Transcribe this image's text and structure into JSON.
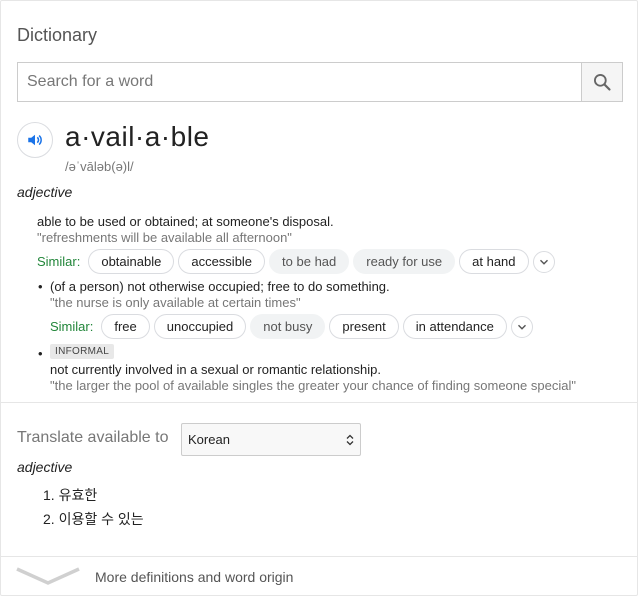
{
  "header": {
    "title": "Dictionary"
  },
  "search": {
    "placeholder": "Search for a word",
    "value": ""
  },
  "entry": {
    "headword": "a·vail·a·ble",
    "phonetic": "/əˈvāləb(ə)l/",
    "pos": "adjective",
    "senses": [
      {
        "definition": "able to be used or obtained; at someone's disposal.",
        "example": "\"refreshments will be available all afternoon\"",
        "similar_label": "Similar:",
        "similar": [
          "obtainable",
          "accessible",
          "to be had",
          "ready for use",
          "at hand"
        ]
      },
      {
        "bullet": "•",
        "definition": "(of a person) not otherwise occupied; free to do something.",
        "example": "\"the nurse is only available at certain times\"",
        "similar_label": "Similar:",
        "similar": [
          "free",
          "unoccupied",
          "not busy",
          "present",
          "in attendance"
        ]
      },
      {
        "bullet": "•",
        "tag": "INFORMAL",
        "definition": "not currently involved in a sexual or romantic relationship.",
        "example": "\"the larger the pool of available singles the greater your chance of finding someone special\""
      }
    ]
  },
  "translate": {
    "label": "Translate available to",
    "language": "Korean",
    "pos": "adjective",
    "items": [
      "1. 유효한",
      "2. 이용할 수 있는"
    ]
  },
  "footer": {
    "more_label": "More definitions and word origin"
  },
  "colors": {
    "similar_label": "#22863a",
    "speaker": "#1a73e8"
  },
  "icons": {
    "search": "search-icon",
    "speaker": "speaker-icon",
    "chevron": "chevron-down-icon"
  }
}
